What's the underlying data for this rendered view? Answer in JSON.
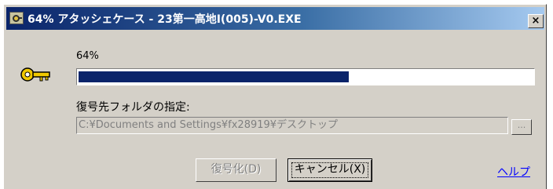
{
  "window": {
    "title": "64% アタッシェケース - 23第一高地Ⅰ(005)-V0.EXE",
    "close_label": "×"
  },
  "progress": {
    "label": "64%",
    "value_percent": 64,
    "fill_color": "#0a246a"
  },
  "destination": {
    "label": "復号先フォルダの指定:",
    "path": "C:¥Documents and Settings¥fx28919¥デスクトップ",
    "browse_label": "..."
  },
  "buttons": {
    "decrypt_label": "復号化(D)",
    "cancel_label": "キャンセル(X)",
    "help_label": "ヘルプ"
  },
  "icons": {
    "app": "app-icon",
    "key": "key-icon",
    "close": "close-icon"
  },
  "colors": {
    "titlebar_start": "#0a246a",
    "titlebar_end": "#a6caf0",
    "dialog_bg": "#d4d0c8",
    "link": "#0000ff",
    "key_gold": "#f0c800"
  }
}
